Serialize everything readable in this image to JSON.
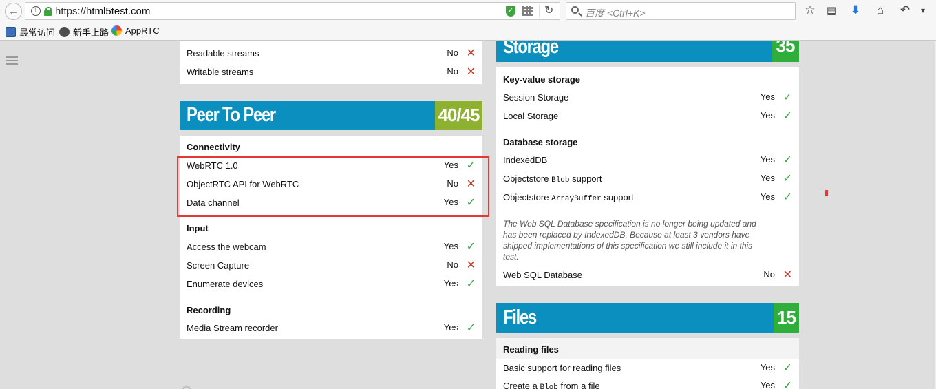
{
  "browser": {
    "url_scheme": "https://",
    "url_host": "html5test.com",
    "search_placeholder": "百度 <Ctrl+K>",
    "bookmarks": [
      "最常访问",
      "新手上路",
      "AppRTC"
    ]
  },
  "left_top_card": {
    "rows": [
      {
        "label": "Readable streams",
        "value": "No",
        "status": "no"
      },
      {
        "label": "Writable streams",
        "value": "No",
        "status": "no"
      }
    ]
  },
  "peer_to_peer": {
    "title": "Peer To Peer",
    "score": "40/45",
    "score_color": "#8fb132",
    "connectivity": {
      "heading": "Connectivity",
      "rows": [
        {
          "label": "WebRTC 1.0",
          "value": "Yes",
          "status": "yes"
        },
        {
          "label": "ObjectRTC API for WebRTC",
          "value": "No",
          "status": "no"
        },
        {
          "label": "Data channel",
          "value": "Yes",
          "status": "yes"
        }
      ]
    },
    "input": {
      "heading": "Input",
      "rows": [
        {
          "label": "Access the webcam",
          "value": "Yes",
          "status": "yes"
        },
        {
          "label": "Screen Capture",
          "value": "No",
          "status": "no"
        },
        {
          "label": "Enumerate devices",
          "value": "Yes",
          "status": "yes"
        }
      ]
    },
    "recording": {
      "heading": "Recording",
      "rows": [
        {
          "label": "Media Stream recorder",
          "value": "Yes",
          "status": "yes"
        }
      ]
    }
  },
  "storage": {
    "title": "Storage",
    "score": "35",
    "score_color": "#2fae3c",
    "key_value": {
      "heading": "Key-value storage",
      "rows": [
        {
          "label": "Session Storage",
          "value": "Yes",
          "status": "yes"
        },
        {
          "label": "Local Storage",
          "value": "Yes",
          "status": "yes"
        }
      ]
    },
    "database": {
      "heading": "Database storage",
      "indexeddb": {
        "label": "IndexedDB",
        "value": "Yes"
      },
      "blob_prefix": "Objectstore ",
      "blob_code": "Blob",
      "blob_suffix": " support",
      "blob_value": "Yes",
      "ab_prefix": "Objectstore ",
      "ab_code": "ArrayBuffer",
      "ab_suffix": " support",
      "ab_value": "Yes"
    },
    "note": "The Web SQL Database specification is no longer being updated and has been replaced by IndexedDB. Because at least 3 vendors have shipped implementations of this specification we still include it in this test.",
    "websql": {
      "label": "Web SQL Database",
      "value": "No",
      "status": "no"
    }
  },
  "files": {
    "title": "Files",
    "score": "15",
    "score_color": "#2fae3c",
    "reading": {
      "heading": "Reading files",
      "basic": {
        "label": "Basic support for reading files",
        "value": "Yes"
      },
      "create_prefix": "Create a ",
      "create_code": "Blob",
      "create_suffix": " from a file",
      "create_value": "Yes"
    }
  },
  "marks": {
    "yes": "✓",
    "no": "✕"
  }
}
